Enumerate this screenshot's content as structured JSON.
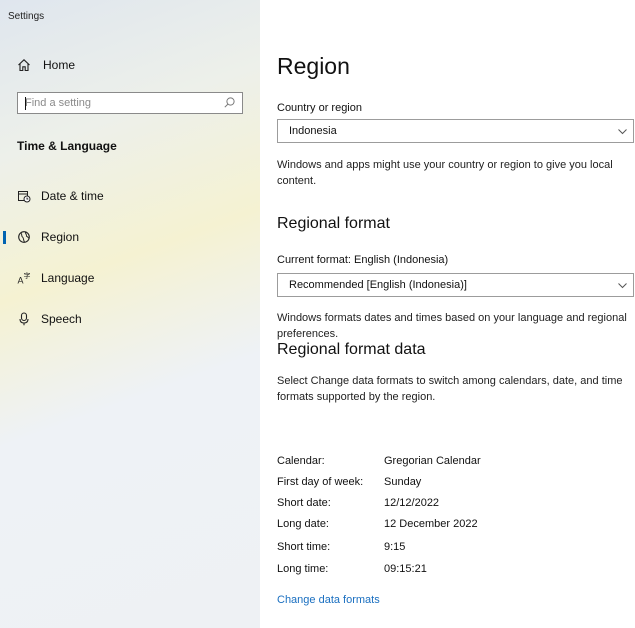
{
  "window": {
    "title": "Settings"
  },
  "sidebar": {
    "home_label": "Home",
    "search": {
      "placeholder": "Find a setting"
    },
    "section_title": "Time & Language",
    "items": [
      {
        "label": "Date & time",
        "icon": "calendar-clock-icon",
        "active": false
      },
      {
        "label": "Region",
        "icon": "globe-icon",
        "active": true
      },
      {
        "label": "Language",
        "icon": "language-icon",
        "active": false
      },
      {
        "label": "Speech",
        "icon": "microphone-icon",
        "active": false
      }
    ]
  },
  "main": {
    "title": "Region",
    "country": {
      "label": "Country or region",
      "selected": "Indonesia",
      "description": "Windows and apps might use your country or region to give you local content."
    },
    "regional_format": {
      "heading": "Regional format",
      "current_label": "Current format: English (Indonesia)",
      "selected": "Recommended [English (Indonesia)]",
      "description": "Windows formats dates and times based on your language and regional preferences."
    },
    "format_data": {
      "heading": "Regional format data",
      "description": "Select Change data formats to switch among calendars, date, and time formats supported by the region.",
      "rows": [
        {
          "key": "Calendar:",
          "value": "Gregorian Calendar"
        },
        {
          "key": "First day of week:",
          "value": "Sunday"
        },
        {
          "key": "Short date:",
          "value": "12/12/2022"
        },
        {
          "key": "Long date:",
          "value": "12 December 2022"
        },
        {
          "key": "Short time:",
          "value": "9:15"
        },
        {
          "key": "Long time:",
          "value": "09:15:21"
        }
      ],
      "change_link": "Change data formats"
    }
  },
  "colors": {
    "accent": "#0063b1",
    "link": "#1a6fc0"
  }
}
